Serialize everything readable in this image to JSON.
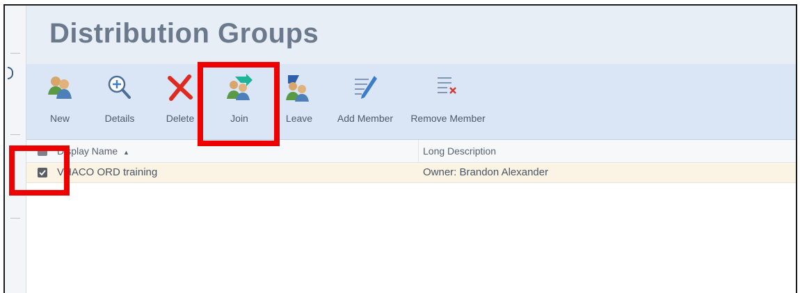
{
  "page": {
    "title": "Distribution Groups"
  },
  "toolbar": {
    "items": [
      {
        "label": "New",
        "icon": "new-group-icon"
      },
      {
        "label": "Details",
        "icon": "magnify-plus-icon"
      },
      {
        "label": "Delete",
        "icon": "delete-x-icon"
      },
      {
        "label": "Join",
        "icon": "join-group-icon"
      },
      {
        "label": "Leave",
        "icon": "leave-group-icon"
      },
      {
        "label": "Add Member",
        "icon": "add-member-icon"
      },
      {
        "label": "Remove Member",
        "icon": "remove-member-icon"
      }
    ]
  },
  "grid": {
    "columns": [
      {
        "label": "Display Name",
        "sort": "ascending",
        "sort_indicator": "▲"
      },
      {
        "label": "Long Description"
      }
    ],
    "rows": [
      {
        "selected": true,
        "display_name": "VHACO ORD training",
        "long_description": "Owner: Brandon Alexander"
      }
    ]
  },
  "annotations": {
    "highlight_color": "#ee0000",
    "highlighted": [
      "Join",
      "row checkbox"
    ]
  },
  "colors": {
    "toolbar_bg": "#dae6f6",
    "title_bg": "#e8eef6",
    "selected_row_bg": "#fbf3e4"
  }
}
